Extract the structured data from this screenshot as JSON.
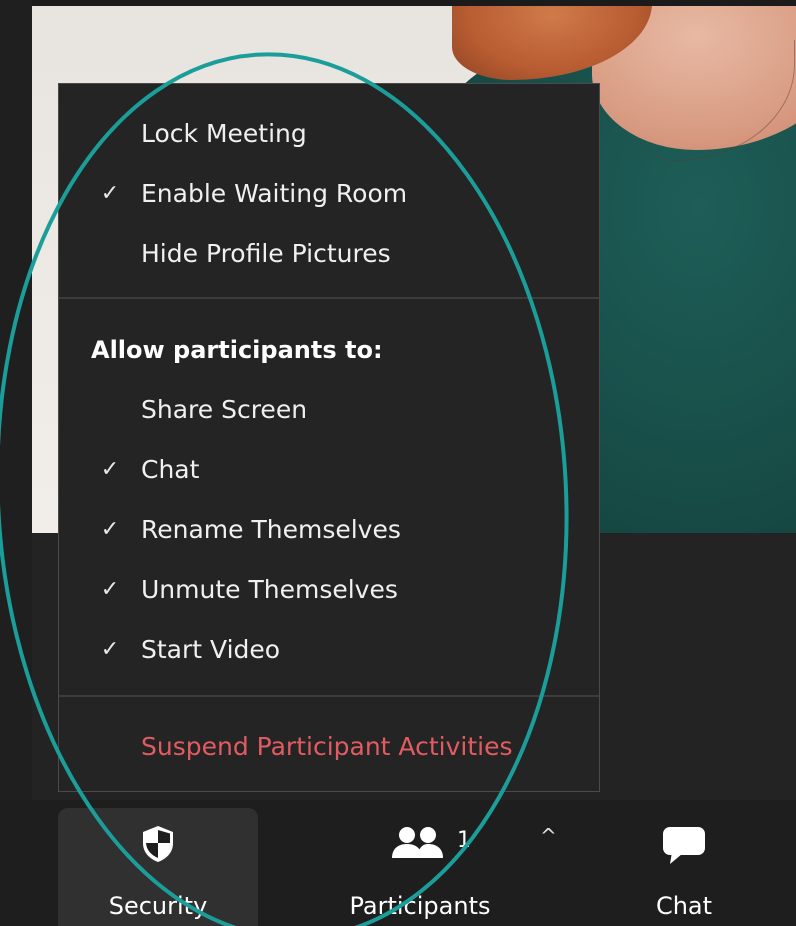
{
  "security_menu": {
    "items": [
      {
        "label": "Lock Meeting",
        "checked": false
      },
      {
        "label": "Enable Waiting Room",
        "checked": true
      },
      {
        "label": "Hide Profile Pictures",
        "checked": false
      }
    ],
    "section_heading": "Allow participants to:",
    "permissions": [
      {
        "label": "Share Screen",
        "checked": false
      },
      {
        "label": "Chat",
        "checked": true
      },
      {
        "label": "Rename Themselves",
        "checked": true
      },
      {
        "label": "Unmute Themselves",
        "checked": true
      },
      {
        "label": "Start Video",
        "checked": true
      }
    ],
    "suspend_label": "Suspend Participant Activities",
    "check_glyph": "✓"
  },
  "toolbar": {
    "security_label": "Security",
    "participants_label": "Participants",
    "participants_count": "1",
    "caret_glyph": "^",
    "chat_label": "Chat"
  },
  "colors": {
    "danger": "#e05c62",
    "annotation": "#1b9e9a",
    "menu_bg": "#242424",
    "toolbar_bg": "#1e1e1e"
  },
  "icons": {
    "security": "shield-icon",
    "participants": "participants-icon",
    "chat": "chat-bubble-icon",
    "checked": "check-icon"
  }
}
